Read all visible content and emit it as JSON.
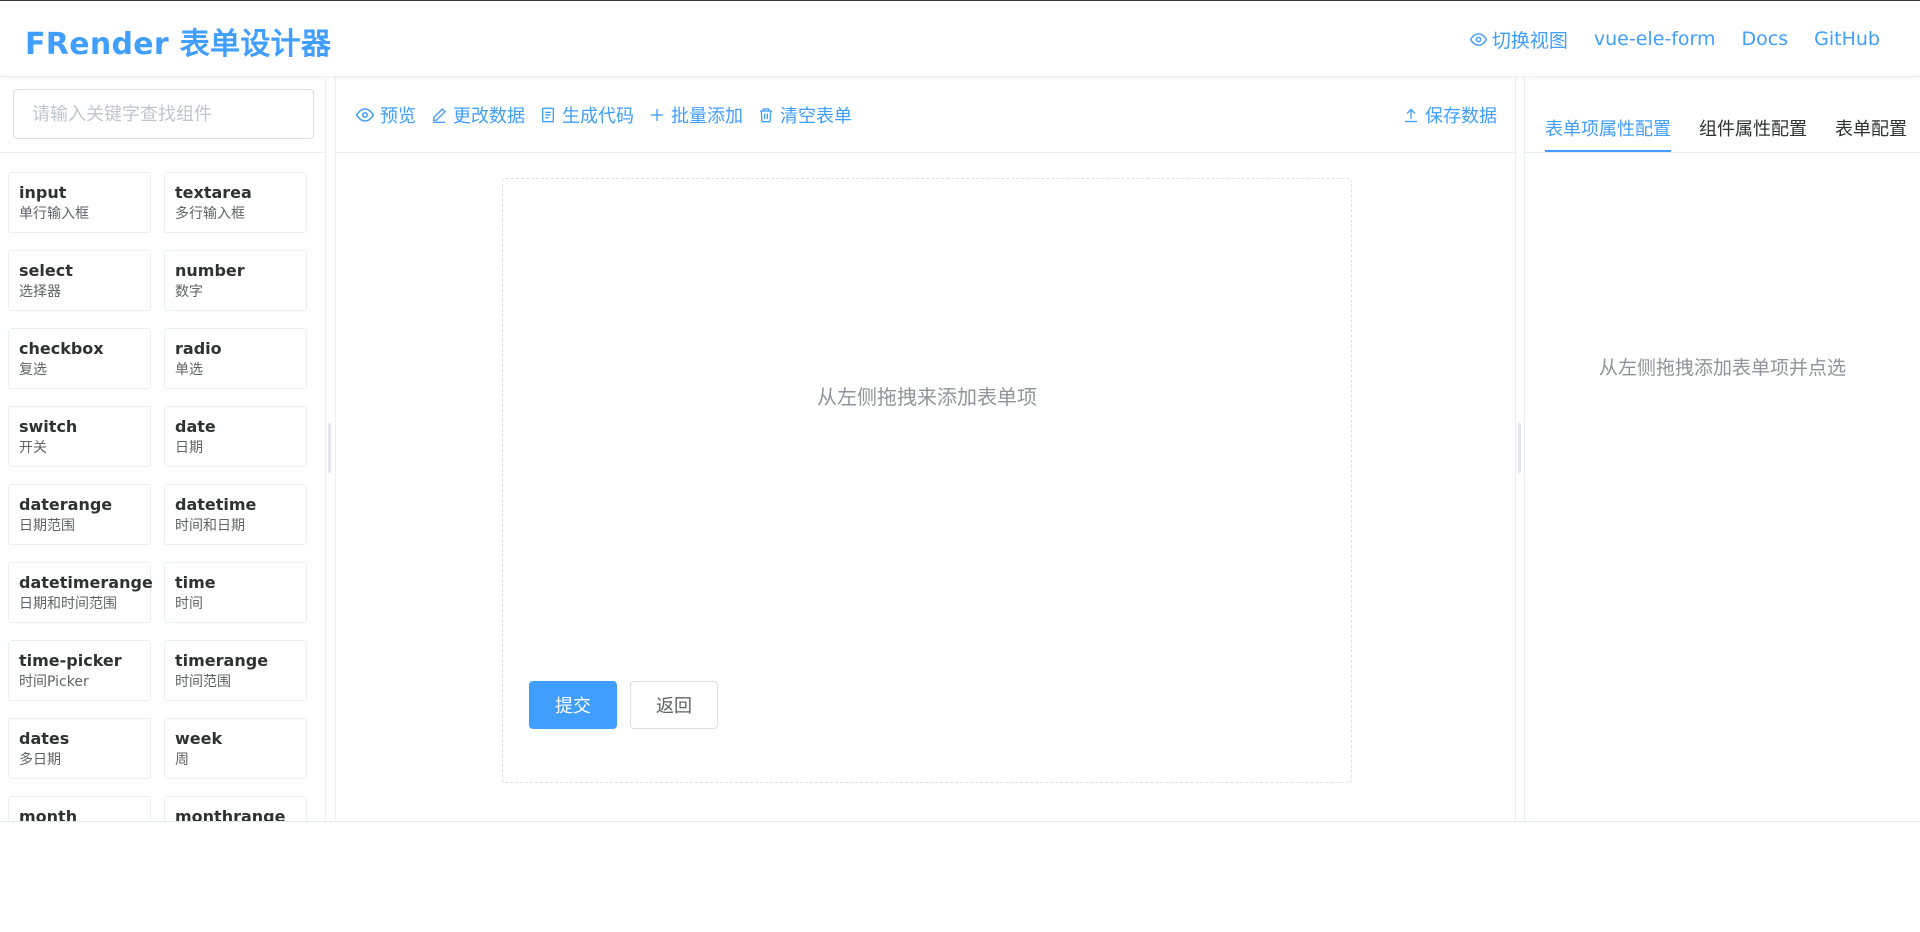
{
  "header": {
    "logo": "FRender 表单设计器",
    "nav": {
      "switch_view": "切换视图",
      "vue_ele_form": "vue-ele-form",
      "docs": "Docs",
      "github": "GitHub"
    }
  },
  "sidebar": {
    "search_placeholder": "请输入关键字查找组件",
    "components": [
      {
        "name": "input",
        "label": "单行输入框"
      },
      {
        "name": "textarea",
        "label": "多行输入框"
      },
      {
        "name": "select",
        "label": "选择器"
      },
      {
        "name": "number",
        "label": "数字"
      },
      {
        "name": "checkbox",
        "label": "复选"
      },
      {
        "name": "radio",
        "label": "单选"
      },
      {
        "name": "switch",
        "label": "开关"
      },
      {
        "name": "date",
        "label": "日期"
      },
      {
        "name": "daterange",
        "label": "日期范围"
      },
      {
        "name": "datetime",
        "label": "时间和日期"
      },
      {
        "name": "datetimerange",
        "label": "日期和时间范围"
      },
      {
        "name": "time",
        "label": "时间"
      },
      {
        "name": "time-picker",
        "label": "时间Picker"
      },
      {
        "name": "timerange",
        "label": "时间范围"
      },
      {
        "name": "dates",
        "label": "多日期"
      },
      {
        "name": "week",
        "label": "周"
      },
      {
        "name": "month",
        "label": ""
      },
      {
        "name": "monthrange",
        "label": ""
      }
    ]
  },
  "toolbar": {
    "preview": "预览",
    "change_data": "更改数据",
    "generate_code": "生成代码",
    "batch_add": "批量添加",
    "clear_form": "清空表单",
    "save_data": "保存数据"
  },
  "canvas": {
    "hint": "从左侧拖拽来添加表单项",
    "submit": "提交",
    "back": "返回"
  },
  "right_panel": {
    "tabs": [
      "表单项属性配置",
      "组件属性配置",
      "表单配置"
    ],
    "hint": "从左侧拖拽添加表单项并点选"
  },
  "colors": {
    "accent": "#409eff",
    "text_primary": "#303133",
    "text_secondary": "#909399",
    "border": "#ebeef5"
  }
}
